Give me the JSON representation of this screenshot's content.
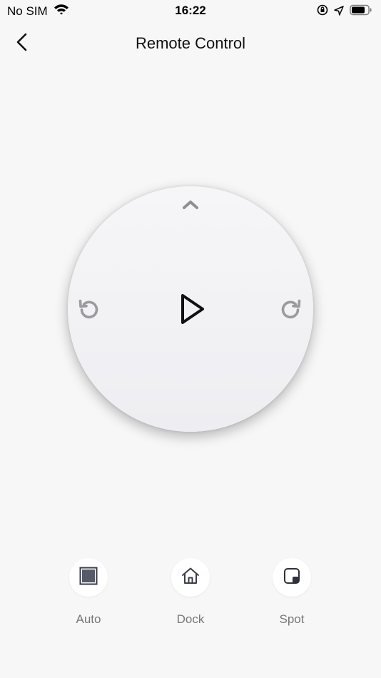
{
  "status_bar": {
    "carrier": "No SIM",
    "time": "16:22",
    "icons": [
      "wifi-icon",
      "orientation-lock-icon",
      "location-icon",
      "battery-icon"
    ]
  },
  "header": {
    "title": "Remote Control",
    "back_icon": "chevron-left-icon"
  },
  "dial": {
    "up_icon": "chevron-up-icon",
    "rotate_left_icon": "rotate-left-icon",
    "rotate_right_icon": "rotate-right-icon",
    "center_icon": "play-icon"
  },
  "modes": [
    {
      "label": "Auto",
      "icon": "stop-square-icon"
    },
    {
      "label": "Dock",
      "icon": "home-icon"
    },
    {
      "label": "Spot",
      "icon": "spot-icon"
    }
  ],
  "colors": {
    "background": "#f7f7f7",
    "dial_icon_gray": "#9a9aa0",
    "play_icon": "#111111",
    "mode_icon": "#555a66",
    "label_gray": "#777777"
  }
}
